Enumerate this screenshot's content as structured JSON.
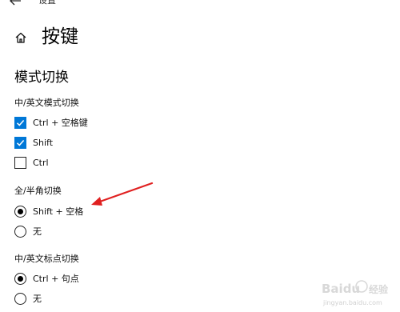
{
  "header": {
    "app_title": "设置",
    "page_title": "按键"
  },
  "section": {
    "title": "模式切换"
  },
  "groups": [
    {
      "label": "中/英文模式切换",
      "type": "checkbox",
      "options": [
        {
          "label": "Ctrl + 空格键",
          "checked": true
        },
        {
          "label": "Shift",
          "checked": true
        },
        {
          "label": "Ctrl",
          "checked": false
        }
      ]
    },
    {
      "label": "全/半角切换",
      "type": "radio",
      "options": [
        {
          "label": "Shift + 空格",
          "checked": true
        },
        {
          "label": "无",
          "checked": false
        }
      ]
    },
    {
      "label": "中/英文标点切换",
      "type": "radio",
      "options": [
        {
          "label": "Ctrl + 句点",
          "checked": true
        },
        {
          "label": "无",
          "checked": false
        }
      ]
    }
  ],
  "watermark": {
    "brand": "Baidu",
    "text": "经验",
    "sub": "jingyan.baidu.com"
  },
  "colors": {
    "accent": "#0078d7",
    "annotation_arrow": "#e02020"
  }
}
